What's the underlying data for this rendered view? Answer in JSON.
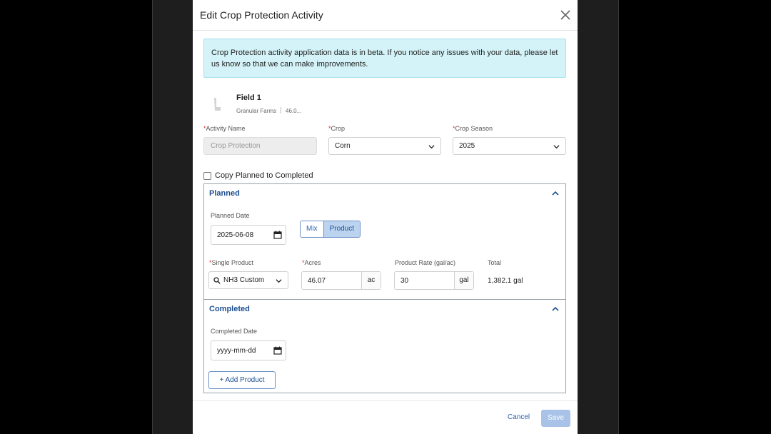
{
  "modal": {
    "title": "Edit Crop Protection Activity",
    "close_icon": "close-icon"
  },
  "alert": {
    "text": "Crop Protection activity application data is in beta. If you notice any issues with your data, please let us know so that we can make improvements."
  },
  "field": {
    "name": "Field 1",
    "farm": "Granular Farms",
    "acres": "46.0..."
  },
  "form": {
    "activity_name": {
      "label": "Activity Name",
      "value": "Crop Protection"
    },
    "crop": {
      "label": "Crop",
      "value": "Corn"
    },
    "crop_season": {
      "label": "Crop Season",
      "value": "2025"
    },
    "copy_planned_label": "Copy Planned to Completed"
  },
  "planned": {
    "title": "Planned",
    "date_label": "Planned Date",
    "date_value": "2025-06-08",
    "toggle": {
      "mix": "Mix",
      "product": "Product",
      "selected": "Product"
    },
    "single_product_label": "Single Product",
    "single_product_value": "NH3 Custom",
    "acres_label": "Acres",
    "acres_value": "46.07",
    "acres_unit": "ac",
    "rate_label": "Product Rate (gal/ac)",
    "rate_value": "30",
    "rate_unit": "gal",
    "total_label": "Total",
    "total_value": "1,382.1 gal"
  },
  "completed": {
    "title": "Completed",
    "date_label": "Completed Date",
    "date_placeholder": "yyyy-mm-dd",
    "add_product_label": "+ Add Product"
  },
  "footer": {
    "cancel_label": "Cancel",
    "save_label": "Save"
  },
  "required_marker": "*",
  "colors": {
    "accent": "#1d4f91",
    "link": "#2c5fb1",
    "alert_bg": "#d4f3f8",
    "save_disabled": "#a9c3e8",
    "required": "#dd3333"
  }
}
